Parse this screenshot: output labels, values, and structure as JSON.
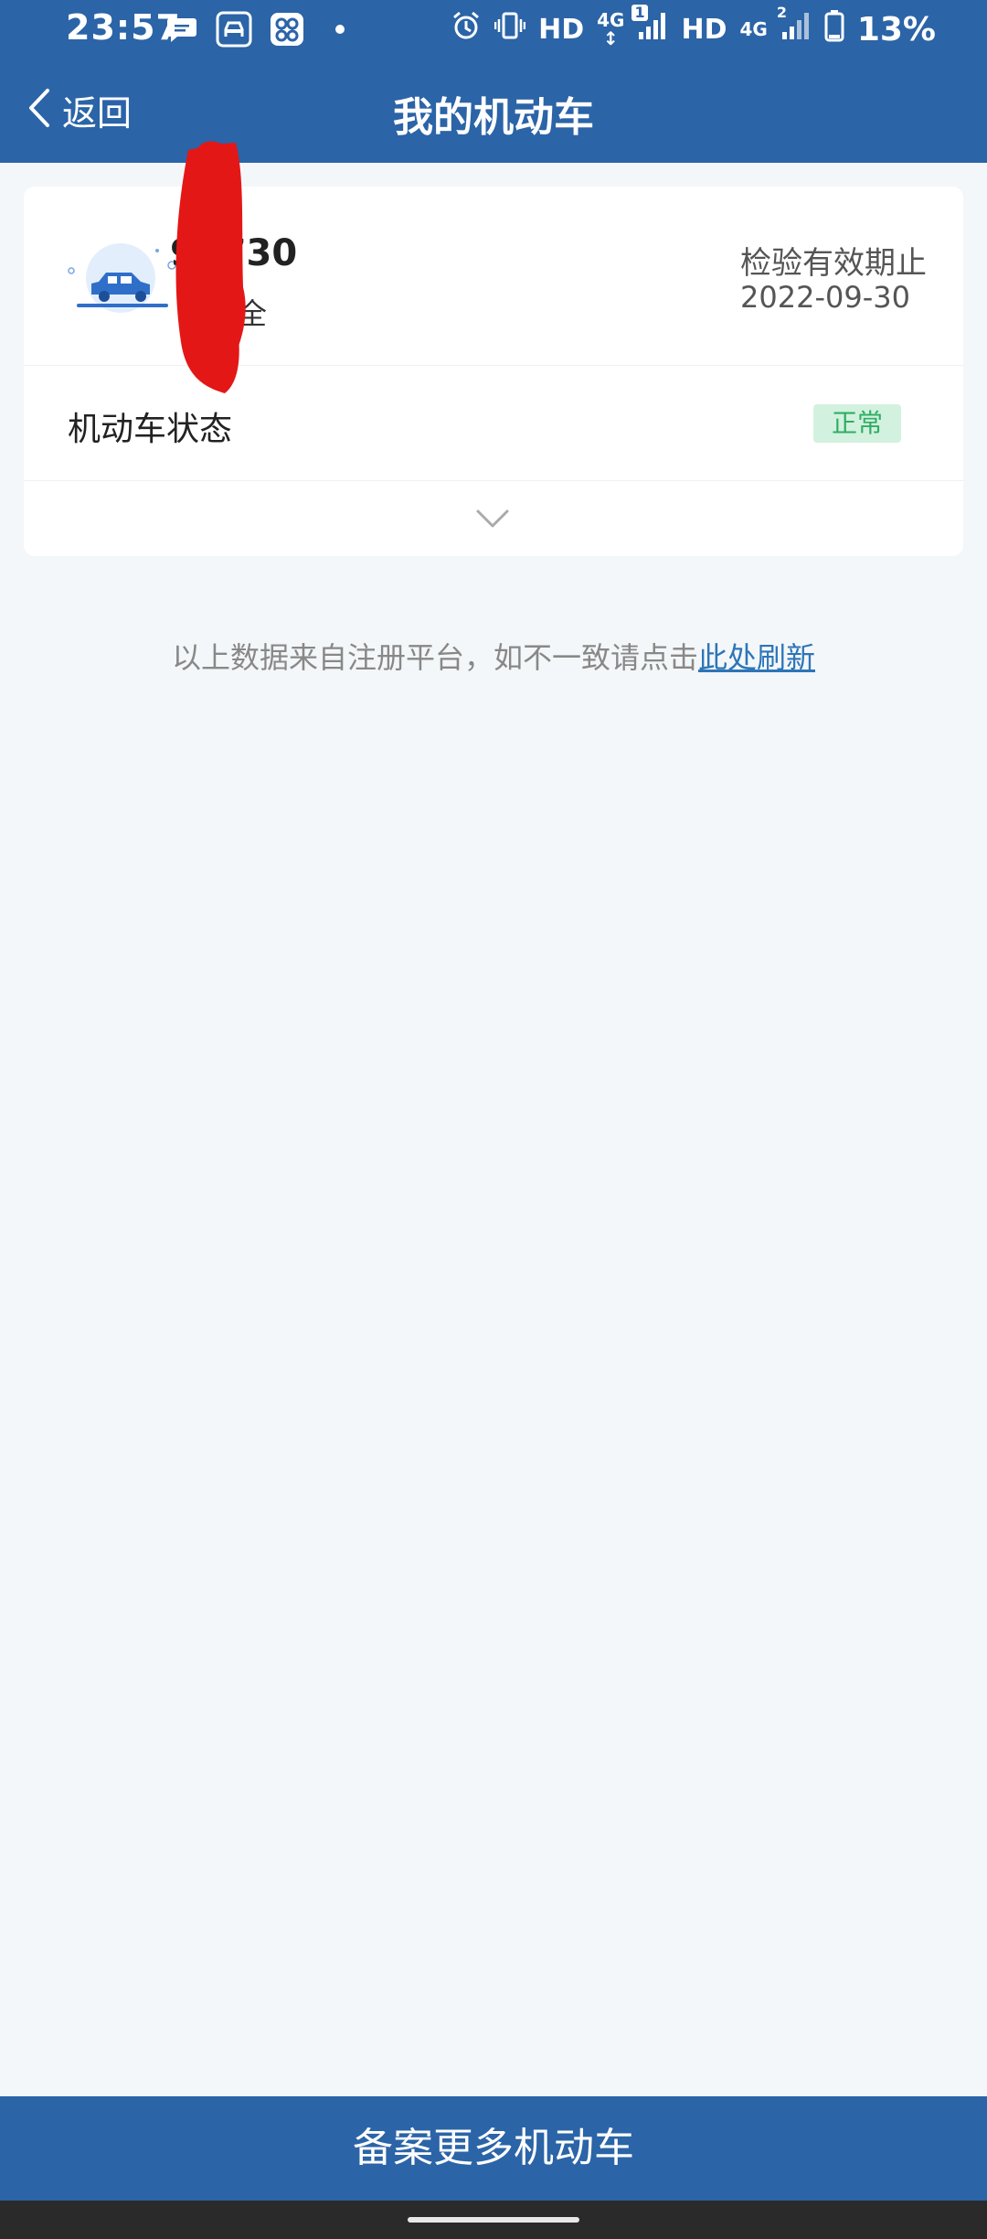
{
  "status_bar": {
    "time": "23:57",
    "hd1": "HD",
    "net1": "4G",
    "sim1": "1",
    "hd2": "HD",
    "net2": "4G",
    "sim2": "2",
    "battery": "13%",
    "icons": [
      "message-icon",
      "car-app-icon",
      "app-icon",
      "dot-icon",
      "alarm-icon",
      "vibrate-icon",
      "signal-icon",
      "battery-icon"
    ]
  },
  "nav": {
    "back_label": "返回",
    "title": "我的机动车"
  },
  "vehicle": {
    "plate": "98730",
    "type": "全",
    "expiry_label": "检验有效期止",
    "expiry_date": "2022-09-30",
    "status_label": "机动车状态",
    "status_value": "正常"
  },
  "note": {
    "text": "以上数据来自注册平台，如不一致请点击",
    "link": "此处刷新"
  },
  "bottom_button": "备案更多机动车",
  "colors": {
    "primary": "#2b64a7",
    "background": "#f4f7f9",
    "status_ok_bg": "#d3f1df",
    "status_ok_text": "#2fae63",
    "link": "#2d75b8"
  }
}
